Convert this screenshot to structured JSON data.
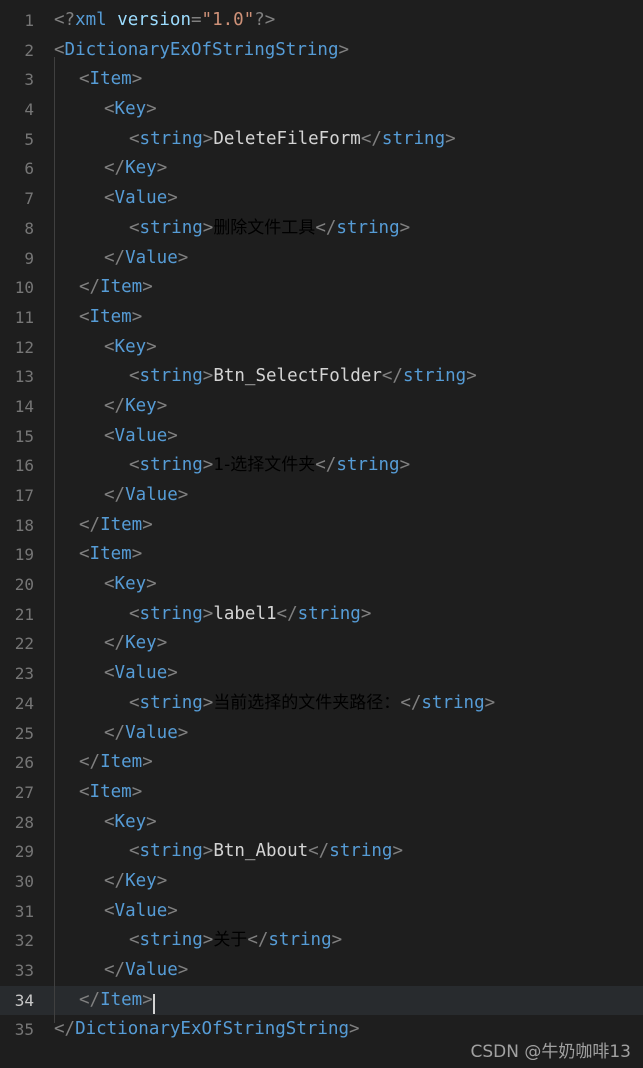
{
  "editor": {
    "language": "xml",
    "active_line": 34,
    "total_lines": 35,
    "theme_background": "#1e1e1e",
    "active_line_background": "#282b2e",
    "gutter_color": "#767676",
    "tag_color": "#569cd6",
    "text_color": "#d4d4d4",
    "punctuation_color": "#808080",
    "attribute_color": "#9cdcfe",
    "attribute_value_color": "#ce9178"
  },
  "watermark": "CSDN @牛奶咖啡13",
  "lines": [
    {
      "num": "1",
      "indent": 0,
      "tokens": [
        {
          "t": "punc",
          "v": "<?"
        },
        {
          "t": "tagname",
          "v": "xml"
        },
        {
          "t": "txt",
          "v": " "
        },
        {
          "t": "attr",
          "v": "version"
        },
        {
          "t": "punc",
          "v": "="
        },
        {
          "t": "attrval",
          "v": "\"1.0\""
        },
        {
          "t": "punc",
          "v": "?>"
        }
      ]
    },
    {
      "num": "2",
      "indent": 0,
      "tokens": [
        {
          "t": "punc",
          "v": "<"
        },
        {
          "t": "tagname",
          "v": "DictionaryExOfStringString"
        },
        {
          "t": "punc",
          "v": ">"
        }
      ]
    },
    {
      "num": "3",
      "indent": 1,
      "tokens": [
        {
          "t": "punc",
          "v": "<"
        },
        {
          "t": "tagname",
          "v": "Item"
        },
        {
          "t": "punc",
          "v": ">"
        }
      ]
    },
    {
      "num": "4",
      "indent": 2,
      "tokens": [
        {
          "t": "punc",
          "v": "<"
        },
        {
          "t": "tagname",
          "v": "Key"
        },
        {
          "t": "punc",
          "v": ">"
        }
      ]
    },
    {
      "num": "5",
      "indent": 3,
      "tokens": [
        {
          "t": "punc",
          "v": "<"
        },
        {
          "t": "tagname",
          "v": "string"
        },
        {
          "t": "punc",
          "v": ">"
        },
        {
          "t": "txt",
          "v": "DeleteFileForm"
        },
        {
          "t": "punc",
          "v": "</"
        },
        {
          "t": "tagname",
          "v": "string"
        },
        {
          "t": "punc",
          "v": ">"
        }
      ]
    },
    {
      "num": "6",
      "indent": 2,
      "tokens": [
        {
          "t": "punc",
          "v": "</"
        },
        {
          "t": "tagname",
          "v": "Key"
        },
        {
          "t": "punc",
          "v": ">"
        }
      ]
    },
    {
      "num": "7",
      "indent": 2,
      "tokens": [
        {
          "t": "punc",
          "v": "<"
        },
        {
          "t": "tagname",
          "v": "Value"
        },
        {
          "t": "punc",
          "v": ">"
        }
      ]
    },
    {
      "num": "8",
      "indent": 3,
      "tokens": [
        {
          "t": "punc",
          "v": "<"
        },
        {
          "t": "tagname",
          "v": "string"
        },
        {
          "t": "punc",
          "v": ">"
        },
        {
          "t": "cn",
          "v": "删除文件工具"
        },
        {
          "t": "punc",
          "v": "</"
        },
        {
          "t": "tagname",
          "v": "string"
        },
        {
          "t": "punc",
          "v": ">"
        }
      ]
    },
    {
      "num": "9",
      "indent": 2,
      "tokens": [
        {
          "t": "punc",
          "v": "</"
        },
        {
          "t": "tagname",
          "v": "Value"
        },
        {
          "t": "punc",
          "v": ">"
        }
      ]
    },
    {
      "num": "10",
      "indent": 1,
      "tokens": [
        {
          "t": "punc",
          "v": "</"
        },
        {
          "t": "tagname",
          "v": "Item"
        },
        {
          "t": "punc",
          "v": ">"
        }
      ]
    },
    {
      "num": "11",
      "indent": 1,
      "tokens": [
        {
          "t": "punc",
          "v": "<"
        },
        {
          "t": "tagname",
          "v": "Item"
        },
        {
          "t": "punc",
          "v": ">"
        }
      ]
    },
    {
      "num": "12",
      "indent": 2,
      "tokens": [
        {
          "t": "punc",
          "v": "<"
        },
        {
          "t": "tagname",
          "v": "Key"
        },
        {
          "t": "punc",
          "v": ">"
        }
      ]
    },
    {
      "num": "13",
      "indent": 3,
      "tokens": [
        {
          "t": "punc",
          "v": "<"
        },
        {
          "t": "tagname",
          "v": "string"
        },
        {
          "t": "punc",
          "v": ">"
        },
        {
          "t": "txt",
          "v": "Btn_SelectFolder"
        },
        {
          "t": "punc",
          "v": "</"
        },
        {
          "t": "tagname",
          "v": "string"
        },
        {
          "t": "punc",
          "v": ">"
        }
      ]
    },
    {
      "num": "14",
      "indent": 2,
      "tokens": [
        {
          "t": "punc",
          "v": "</"
        },
        {
          "t": "tagname",
          "v": "Key"
        },
        {
          "t": "punc",
          "v": ">"
        }
      ]
    },
    {
      "num": "15",
      "indent": 2,
      "tokens": [
        {
          "t": "punc",
          "v": "<"
        },
        {
          "t": "tagname",
          "v": "Value"
        },
        {
          "t": "punc",
          "v": ">"
        }
      ]
    },
    {
      "num": "16",
      "indent": 3,
      "tokens": [
        {
          "t": "punc",
          "v": "<"
        },
        {
          "t": "tagname",
          "v": "string"
        },
        {
          "t": "punc",
          "v": ">"
        },
        {
          "t": "cn",
          "v": "1-选择文件夹"
        },
        {
          "t": "punc",
          "v": "</"
        },
        {
          "t": "tagname",
          "v": "string"
        },
        {
          "t": "punc",
          "v": ">"
        }
      ]
    },
    {
      "num": "17",
      "indent": 2,
      "tokens": [
        {
          "t": "punc",
          "v": "</"
        },
        {
          "t": "tagname",
          "v": "Value"
        },
        {
          "t": "punc",
          "v": ">"
        }
      ]
    },
    {
      "num": "18",
      "indent": 1,
      "tokens": [
        {
          "t": "punc",
          "v": "</"
        },
        {
          "t": "tagname",
          "v": "Item"
        },
        {
          "t": "punc",
          "v": ">"
        }
      ]
    },
    {
      "num": "19",
      "indent": 1,
      "tokens": [
        {
          "t": "punc",
          "v": "<"
        },
        {
          "t": "tagname",
          "v": "Item"
        },
        {
          "t": "punc",
          "v": ">"
        }
      ]
    },
    {
      "num": "20",
      "indent": 2,
      "tokens": [
        {
          "t": "punc",
          "v": "<"
        },
        {
          "t": "tagname",
          "v": "Key"
        },
        {
          "t": "punc",
          "v": ">"
        }
      ]
    },
    {
      "num": "21",
      "indent": 3,
      "tokens": [
        {
          "t": "punc",
          "v": "<"
        },
        {
          "t": "tagname",
          "v": "string"
        },
        {
          "t": "punc",
          "v": ">"
        },
        {
          "t": "txt",
          "v": "label1"
        },
        {
          "t": "punc",
          "v": "</"
        },
        {
          "t": "tagname",
          "v": "string"
        },
        {
          "t": "punc",
          "v": ">"
        }
      ]
    },
    {
      "num": "22",
      "indent": 2,
      "tokens": [
        {
          "t": "punc",
          "v": "</"
        },
        {
          "t": "tagname",
          "v": "Key"
        },
        {
          "t": "punc",
          "v": ">"
        }
      ]
    },
    {
      "num": "23",
      "indent": 2,
      "tokens": [
        {
          "t": "punc",
          "v": "<"
        },
        {
          "t": "tagname",
          "v": "Value"
        },
        {
          "t": "punc",
          "v": ">"
        }
      ]
    },
    {
      "num": "24",
      "indent": 3,
      "tokens": [
        {
          "t": "punc",
          "v": "<"
        },
        {
          "t": "tagname",
          "v": "string"
        },
        {
          "t": "punc",
          "v": ">"
        },
        {
          "t": "cn",
          "v": "当前选择的文件夹路径："
        },
        {
          "t": "punc",
          "v": "</"
        },
        {
          "t": "tagname",
          "v": "string"
        },
        {
          "t": "punc",
          "v": ">"
        }
      ]
    },
    {
      "num": "25",
      "indent": 2,
      "tokens": [
        {
          "t": "punc",
          "v": "</"
        },
        {
          "t": "tagname",
          "v": "Value"
        },
        {
          "t": "punc",
          "v": ">"
        }
      ]
    },
    {
      "num": "26",
      "indent": 1,
      "tokens": [
        {
          "t": "punc",
          "v": "</"
        },
        {
          "t": "tagname",
          "v": "Item"
        },
        {
          "t": "punc",
          "v": ">"
        }
      ]
    },
    {
      "num": "27",
      "indent": 1,
      "tokens": [
        {
          "t": "punc",
          "v": "<"
        },
        {
          "t": "tagname",
          "v": "Item"
        },
        {
          "t": "punc",
          "v": ">"
        }
      ]
    },
    {
      "num": "28",
      "indent": 2,
      "tokens": [
        {
          "t": "punc",
          "v": "<"
        },
        {
          "t": "tagname",
          "v": "Key"
        },
        {
          "t": "punc",
          "v": ">"
        }
      ]
    },
    {
      "num": "29",
      "indent": 3,
      "tokens": [
        {
          "t": "punc",
          "v": "<"
        },
        {
          "t": "tagname",
          "v": "string"
        },
        {
          "t": "punc",
          "v": ">"
        },
        {
          "t": "txt",
          "v": "Btn_About"
        },
        {
          "t": "punc",
          "v": "</"
        },
        {
          "t": "tagname",
          "v": "string"
        },
        {
          "t": "punc",
          "v": ">"
        }
      ]
    },
    {
      "num": "30",
      "indent": 2,
      "tokens": [
        {
          "t": "punc",
          "v": "</"
        },
        {
          "t": "tagname",
          "v": "Key"
        },
        {
          "t": "punc",
          "v": ">"
        }
      ]
    },
    {
      "num": "31",
      "indent": 2,
      "tokens": [
        {
          "t": "punc",
          "v": "<"
        },
        {
          "t": "tagname",
          "v": "Value"
        },
        {
          "t": "punc",
          "v": ">"
        }
      ]
    },
    {
      "num": "32",
      "indent": 3,
      "tokens": [
        {
          "t": "punc",
          "v": "<"
        },
        {
          "t": "tagname",
          "v": "string"
        },
        {
          "t": "punc",
          "v": ">"
        },
        {
          "t": "cn",
          "v": "关于"
        },
        {
          "t": "punc",
          "v": "</"
        },
        {
          "t": "tagname",
          "v": "string"
        },
        {
          "t": "punc",
          "v": ">"
        }
      ]
    },
    {
      "num": "33",
      "indent": 2,
      "tokens": [
        {
          "t": "punc",
          "v": "</"
        },
        {
          "t": "tagname",
          "v": "Value"
        },
        {
          "t": "punc",
          "v": ">"
        }
      ]
    },
    {
      "num": "34",
      "indent": 1,
      "active": true,
      "cursor_after": true,
      "tokens": [
        {
          "t": "punc",
          "v": "</"
        },
        {
          "t": "tagname",
          "v": "Item"
        },
        {
          "t": "punc",
          "v": ">"
        }
      ]
    },
    {
      "num": "35",
      "indent": 0,
      "tokens": [
        {
          "t": "punc",
          "v": "</"
        },
        {
          "t": "tagname",
          "v": "DictionaryExOfStringString"
        },
        {
          "t": "punc",
          "v": ">"
        }
      ]
    }
  ]
}
